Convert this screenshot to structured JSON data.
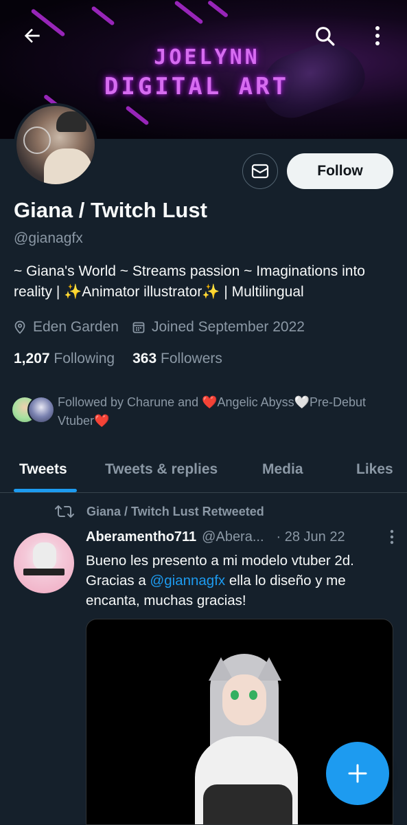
{
  "banner": {
    "line1": "JOELYNN",
    "line2": "DIGITAL ART"
  },
  "header": {
    "back_icon": "arrow-left-icon",
    "search_icon": "search-icon",
    "more_icon": "more-vertical-icon"
  },
  "profile": {
    "name": "Giana / Twitch Lust",
    "handle": "@gianagfx",
    "bio": "~ Giana's World ~ Streams passion ~ Imaginations into reality | ✨Animator illustrator✨ | Multilingual",
    "location": "Eden Garden",
    "joined": "Joined September 2022",
    "following_count": "1,207",
    "following_label": "Following",
    "followers_count": "363",
    "followers_label": "Followers",
    "followed_by": "Followed by Charune and ❤️Angelic Abyss🤍Pre-Debut Vtuber❤️"
  },
  "actions": {
    "follow_label": "Follow",
    "message_icon": "envelope-icon"
  },
  "tabs": [
    {
      "label": "Tweets",
      "active": true
    },
    {
      "label": "Tweets & replies",
      "active": false
    },
    {
      "label": "Media",
      "active": false
    },
    {
      "label": "Likes",
      "active": false
    }
  ],
  "tweet": {
    "retweet_label": "Giana / Twitch Lust Retweeted",
    "author": "Aberamentho711",
    "handle": "@Abera...",
    "date": "· 28 Jun 22",
    "text_before": "Bueno les presento a mi modelo vtuber 2d. Gracias a ",
    "mention": "@giannagfx",
    "text_after": " ella lo diseño y me encanta, muchas gracias!"
  },
  "colors": {
    "background": "#15202b",
    "accent": "#1d9bf0",
    "secondary_text": "#8b98a5"
  }
}
